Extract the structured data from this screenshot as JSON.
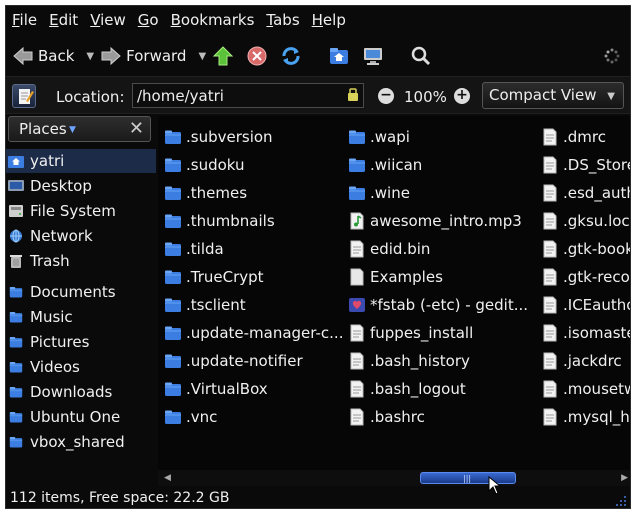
{
  "menu": [
    "File",
    "Edit",
    "View",
    "Go",
    "Bookmarks",
    "Tabs",
    "Help"
  ],
  "menu_mnemonic": [
    "F",
    "E",
    "V",
    "G",
    "B",
    "T",
    "H"
  ],
  "menu_rest": [
    "ile",
    "dit",
    "iew",
    "o",
    "ookmarks",
    "abs",
    "elp"
  ],
  "toolbar": {
    "back_label": "Back",
    "forward_label": "Forward"
  },
  "location": {
    "label": "Location:",
    "value": "/home/yatri",
    "zoom": "100%",
    "view": "Compact View"
  },
  "sidebar": {
    "title": "Places",
    "items": [
      "yatri",
      "Desktop",
      "File System",
      "Network",
      "Trash",
      "Documents",
      "Music",
      "Pictures",
      "Videos",
      "Downloads",
      "Ubuntu One",
      "vbox_shared"
    ],
    "icons": [
      "home-icon",
      "desktop-icon",
      "drive-icon",
      "network-icon",
      "trash-icon",
      "folder-icon",
      "folder-icon",
      "folder-icon",
      "folder-icon",
      "folder-icon",
      "folder-icon",
      "folder-icon"
    ]
  },
  "files": {
    "col1": [
      ".subversion",
      ".sudoku",
      ".themes",
      ".thumbnails",
      ".tilda",
      ".TrueCrypt",
      ".tsclient",
      ".update-manager-c...",
      ".update-notifier",
      ".VirtualBox",
      ".vnc"
    ],
    "col2": [
      ".wapi",
      ".wiican",
      ".wine",
      "awesome_intro.mp3",
      "edid.bin",
      "Examples",
      "*fstab (-etc) - gedit...",
      "fuppes_install",
      ".bash_history",
      ".bash_logout",
      ".bashrc"
    ],
    "col2_icons": [
      "folder-icon",
      "folder-icon",
      "folder-icon",
      "audio-file-icon",
      "text-file-icon",
      "examples-icon",
      "gedit-icon",
      "text-file-icon",
      "text-file-icon",
      "text-file-icon",
      "text-file-icon"
    ],
    "col3": [
      ".dmrc",
      ".DS_Store",
      ".esd_auth",
      ".gksu.lock",
      ".gtk-bookmarks",
      ".gtk-recordmydesktop",
      ".ICEauthority",
      ".isomaster",
      ".jackdrc",
      ".mousetweaks",
      ".mysql_history"
    ]
  },
  "status": "112 items, Free space: 22.2 GB",
  "colors": {
    "background": "#0a0a0a",
    "folder": "#3b7de0",
    "selection": "#1c2b48",
    "scroll_thumb": "#3a6ad0"
  }
}
